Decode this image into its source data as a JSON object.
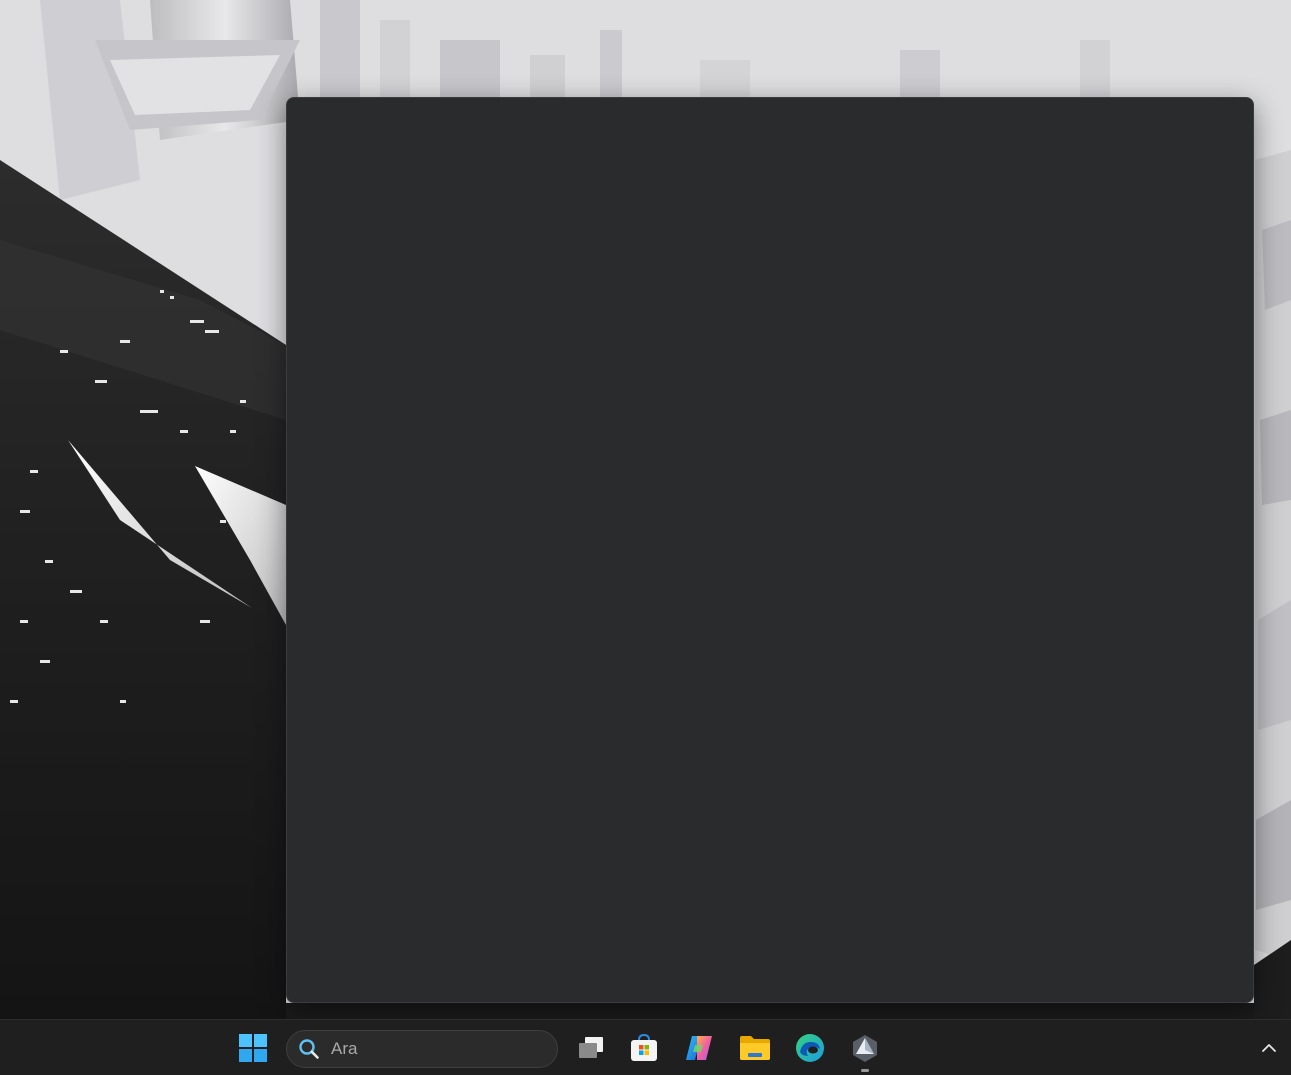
{
  "desktop": {
    "wallpaper": "monochrome-futuristic-city",
    "colors": {
      "light": "#e2e2e4",
      "dark": "#1c1c1c"
    }
  },
  "window": {
    "state": "blank",
    "background": "#2a2b2c"
  },
  "taskbar": {
    "background": "#1f1f1f",
    "search": {
      "placeholder": "Ara",
      "icon": "search-icon"
    },
    "apps": [
      {
        "name": "start",
        "icon": "windows-logo-icon"
      },
      {
        "name": "task-view",
        "icon": "task-view-icon"
      },
      {
        "name": "store",
        "icon": "microsoft-store-icon"
      },
      {
        "name": "copilot",
        "icon": "copilot-icon"
      },
      {
        "name": "file-explorer",
        "icon": "folder-icon"
      },
      {
        "name": "edge",
        "icon": "edge-icon"
      },
      {
        "name": "app",
        "icon": "hexagon-app-icon",
        "running": true
      }
    ],
    "tray": {
      "icon": "chevron-up-icon"
    }
  }
}
